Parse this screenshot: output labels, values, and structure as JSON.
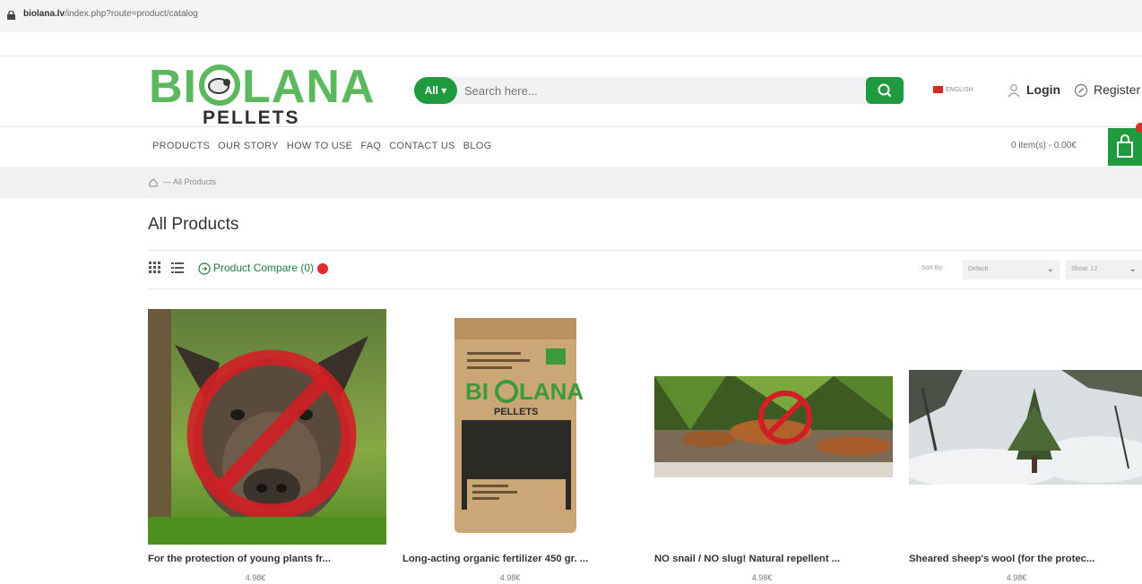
{
  "browser": {
    "url_host": "biolana.lv",
    "url_path": "/index.php?route=product/catalog"
  },
  "brand": {
    "logo_main_left": "BI",
    "logo_main_right": "LANA",
    "logo_sub": "PELLETS"
  },
  "search": {
    "category": "All ▾",
    "placeholder": "Search here..."
  },
  "language": {
    "label": "ENGLISH"
  },
  "account": {
    "login": "Login",
    "register": "Register"
  },
  "nav": [
    "PRODUCTS",
    "OUR STORY",
    "HOW TO USE",
    "FAQ",
    "CONTACT US",
    "BLOG"
  ],
  "cart": {
    "summary": "0 item(s) - 0.00€",
    "count": "0"
  },
  "breadcrumb": {
    "current": "— All Products"
  },
  "page_title": "All Products",
  "toolbar": {
    "compare_label": "Product Compare (0)",
    "compare_count": "0"
  },
  "sort": {
    "label": "Sort By:",
    "value": "Default"
  },
  "limit": {
    "label": "Show:",
    "value": "12"
  },
  "products": [
    {
      "name": "For the protection of young plants fr...",
      "price": "4.98€"
    },
    {
      "name": "Long-acting organic fertilizer 450 gr. ...",
      "price": "4.98€"
    },
    {
      "name": "NO snail / NO slug! Natural repellent ...",
      "price": "4.98€"
    },
    {
      "name": "Sheared sheep's wool (for the protec...",
      "price": "4.98€"
    }
  ],
  "package_label": {
    "logo_left": "BI",
    "logo_right": "LANA",
    "sub": "PELLETS"
  },
  "colors": {
    "brand_green": "#5cb85c",
    "accent_green": "#1f9a3e",
    "badge_red": "#e32b2b"
  }
}
